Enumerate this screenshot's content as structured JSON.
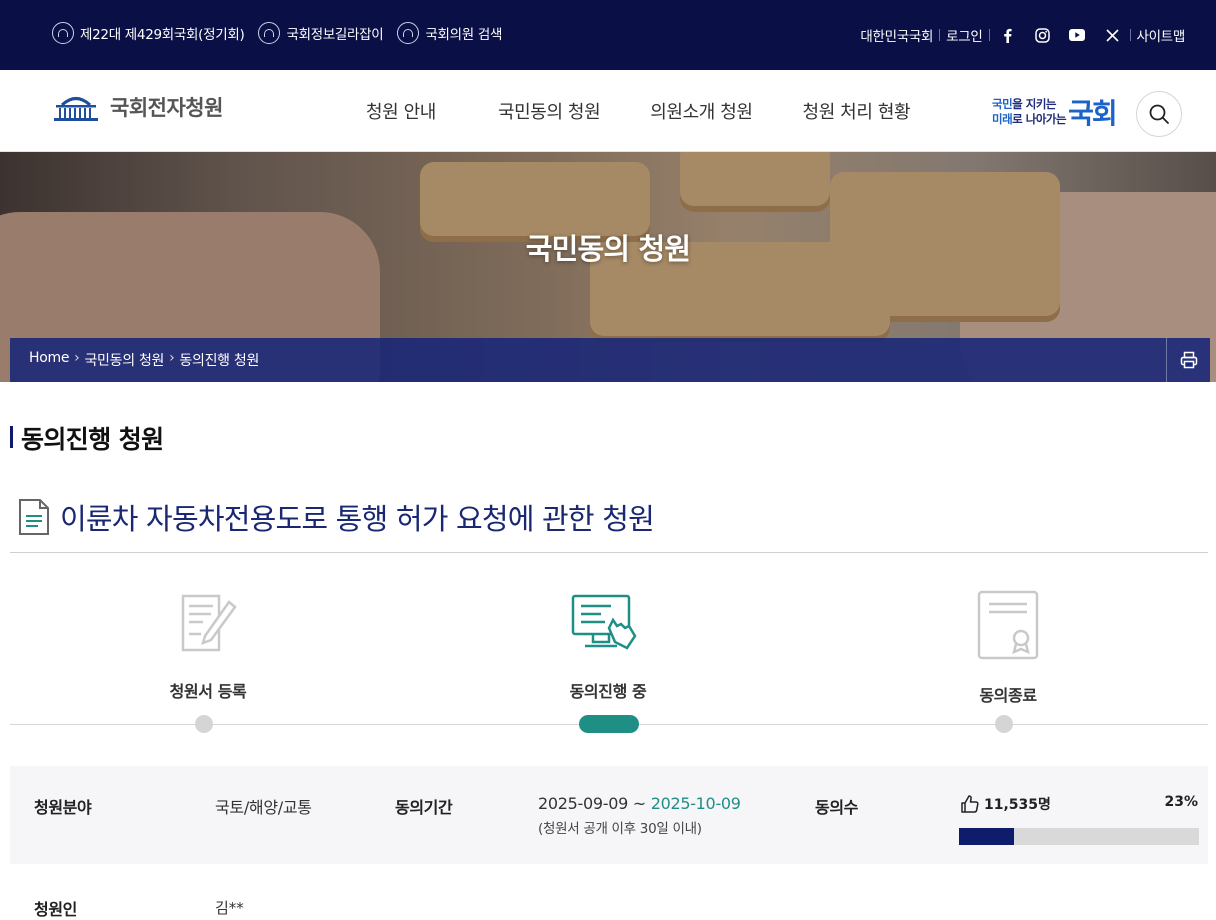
{
  "topbar": {
    "links": [
      "제22대 제429회국회(정기회)",
      "국회정보길라잡이",
      "국회의원 검색"
    ],
    "right_links": [
      "대한민국국회",
      "로그인"
    ],
    "sns": [
      "facebook-icon",
      "instagram-icon",
      "youtube-icon",
      "x-icon"
    ],
    "sitemap": "사이트맵"
  },
  "header": {
    "logo": "국회전자청원",
    "menu": [
      "청원 안내",
      "국민동의 청원",
      "의원소개 청원",
      "청원 처리 현황"
    ],
    "slogan_line1_a": "국민",
    "slogan_line1_b": "을 지키는",
    "slogan_line2_a": "미래",
    "slogan_line2_b": "로 나아가는",
    "slogan_big": "국회"
  },
  "hero": {
    "title": "국민동의 청원",
    "breadcrumb": [
      "Home",
      "국민동의 청원",
      "동의진행 청원"
    ]
  },
  "page": {
    "section_title": "동의진행 청원",
    "petition_title": "이륜차 자동차전용도로 통행 허가 요청에 관한 청원"
  },
  "steps": {
    "items": [
      "청원서 등록",
      "동의진행 중",
      "동의종료"
    ],
    "active_index": 1
  },
  "info": {
    "field_label": "청원분야",
    "field_value": "국토/해양/교통",
    "period_label": "동의기간",
    "period_start": "2025-09-09",
    "period_sep": " ~ ",
    "period_end": "2025-10-09",
    "period_note": "(청원서 공개 이후 30일 이내)",
    "count_label": "동의수",
    "count_value": "11,535명",
    "percent_text": "23%",
    "progress_fraction": 0.23,
    "petitioner_label": "청원인",
    "petitioner_value": "김**"
  },
  "colors": {
    "topbar": "#0a0f45",
    "accent_teal": "#1f8f86",
    "navy": "#0e1d6b"
  }
}
